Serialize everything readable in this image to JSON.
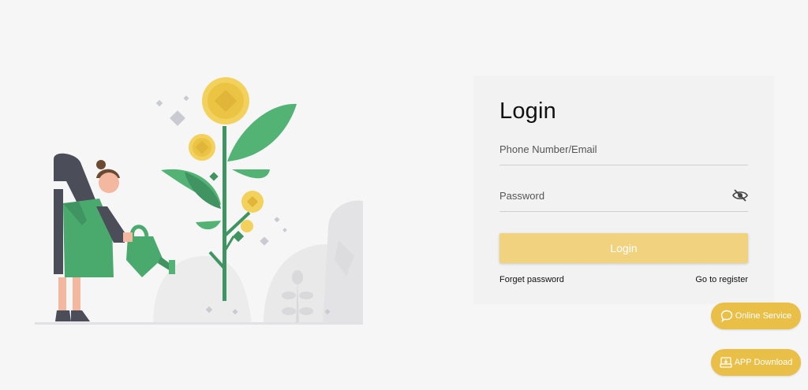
{
  "login": {
    "title": "Login",
    "phone_placeholder": "Phone Number/Email",
    "password_placeholder": "Password",
    "button_label": "Login",
    "forget_password": "Forget password",
    "go_to_register": "Go to register"
  },
  "floating": {
    "online_service": "Online Service",
    "app_download": "APP Download"
  },
  "icons": {
    "password_toggle": "eye-slash-icon",
    "online_service": "chat-bubble-icon",
    "app_download": "app-download-icon"
  },
  "colors": {
    "background": "#f6f6f6",
    "card": "#f2f2f2",
    "login_button": "#f0d27f",
    "floating_button": "#e9bf47",
    "plant_green": "#4aa96c",
    "coin_yellow": "#f2d25c"
  }
}
